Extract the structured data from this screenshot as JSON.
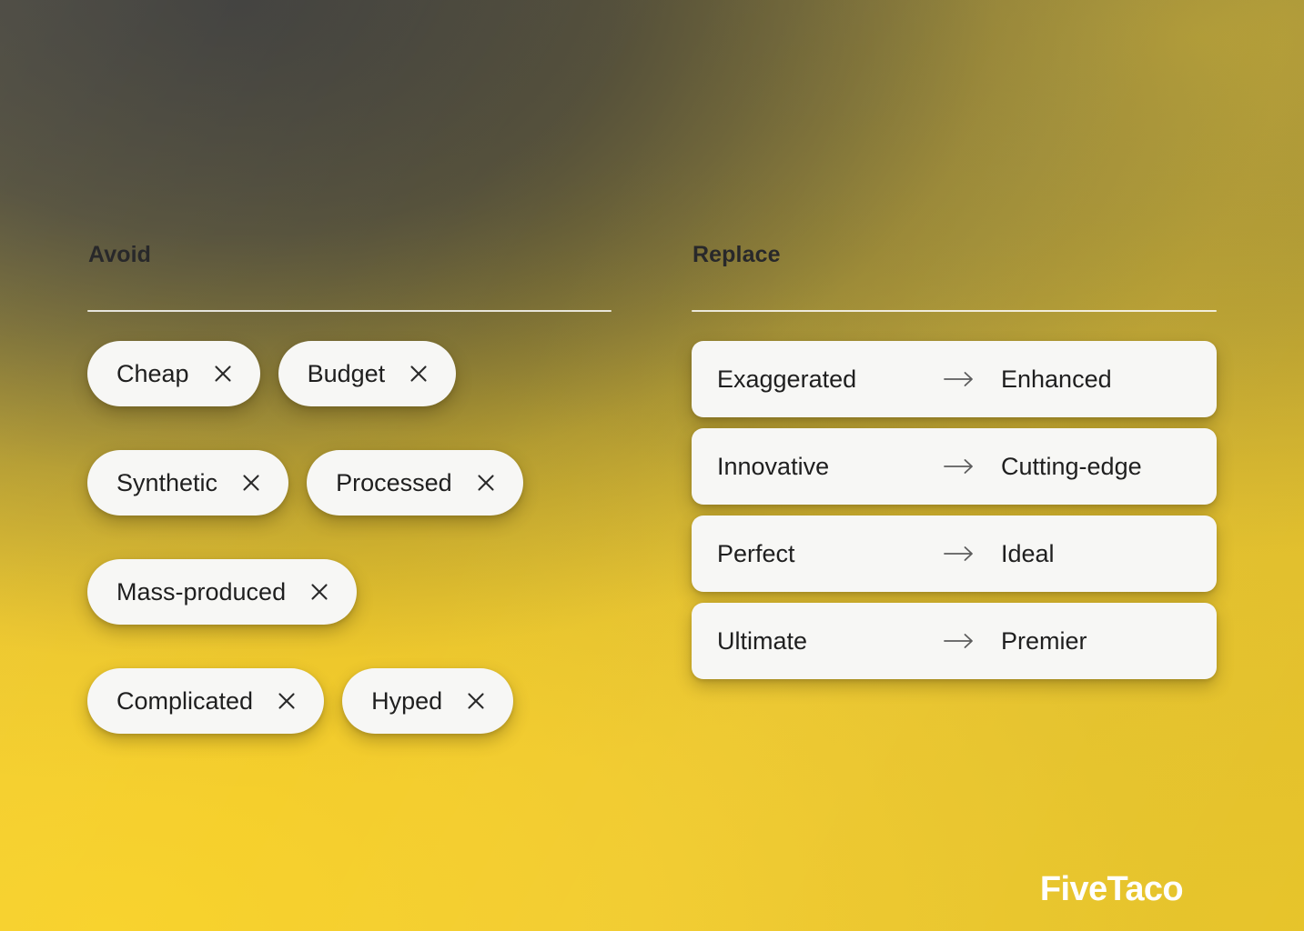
{
  "avoid": {
    "title": "Avoid",
    "remove_icon": "close-icon",
    "items": [
      {
        "label": "Cheap"
      },
      {
        "label": "Budget"
      },
      {
        "label": "Synthetic"
      },
      {
        "label": "Processed"
      },
      {
        "label": "Mass-produced"
      },
      {
        "label": "Complicated"
      },
      {
        "label": "Hyped"
      }
    ]
  },
  "replace": {
    "title": "Replace",
    "arrow_icon": "arrow-right-icon",
    "rows": [
      {
        "from": "Exaggerated",
        "to": "Enhanced"
      },
      {
        "from": "Innovative",
        "to": "Cutting-edge"
      },
      {
        "from": "Perfect",
        "to": "Ideal"
      },
      {
        "from": "Ultimate",
        "to": "Premier"
      }
    ]
  },
  "brand": {
    "name": "FiveTaco"
  },
  "colors": {
    "chip_background": "#f7f7f5",
    "text": "#1f1f1f",
    "title": "#28282a",
    "arrow": "#5d5d5d",
    "brand": "#ffffff",
    "background_top_left": "#585650",
    "background_top_right": "#b8a233",
    "background_bottom_left": "#f7d02e",
    "background_bottom_right": "#e8c62c",
    "divider": "#ffffff"
  }
}
